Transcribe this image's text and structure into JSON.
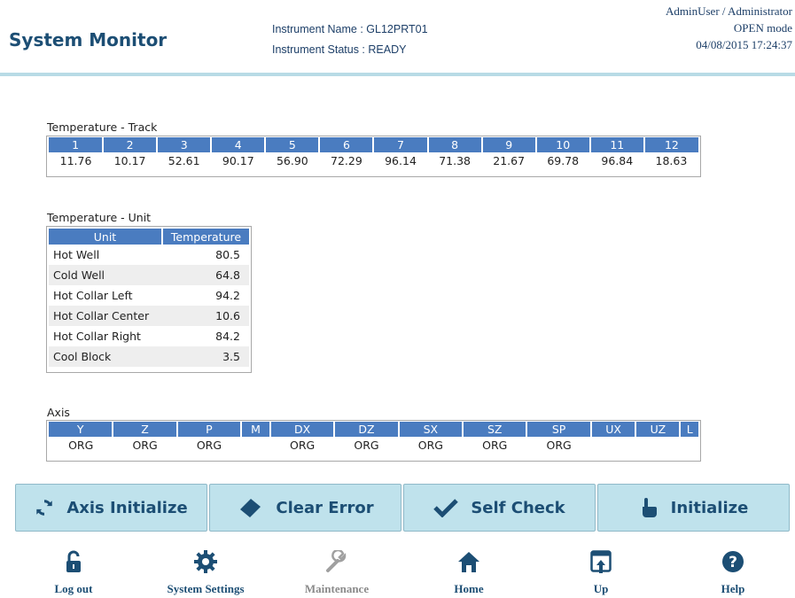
{
  "header": {
    "title": "System Monitor",
    "instrument_name": "Instrument Name :  GL12PRT01",
    "instrument_status": "Instrument Status : READY",
    "user": "AdminUser / Administrator",
    "mode": "OPEN mode",
    "datetime": "04/08/2015 17:24:37"
  },
  "track": {
    "label": "Temperature - Track",
    "headers": [
      "1",
      "2",
      "3",
      "4",
      "5",
      "6",
      "7",
      "8",
      "9",
      "10",
      "11",
      "12"
    ],
    "values": [
      "11.76",
      "10.17",
      "52.61",
      "90.17",
      "56.90",
      "72.29",
      "96.14",
      "71.38",
      "21.67",
      "69.78",
      "96.84",
      "18.63"
    ]
  },
  "unit": {
    "label": "Temperature - Unit",
    "col_unit": "Unit",
    "col_temp": "Temperature",
    "rows": [
      {
        "name": "Hot Well",
        "value": "80.5"
      },
      {
        "name": "Cold Well",
        "value": "64.8"
      },
      {
        "name": "Hot Collar Left",
        "value": "94.2"
      },
      {
        "name": "Hot Collar Center",
        "value": "10.6"
      },
      {
        "name": "Hot Collar Right",
        "value": "84.2"
      },
      {
        "name": "Cool Block",
        "value": "3.5"
      }
    ]
  },
  "axis": {
    "label": "Axis",
    "headers": [
      "Y",
      "Z",
      "P",
      "M",
      "DX",
      "DZ",
      "SX",
      "SZ",
      "SP",
      "UX",
      "UZ",
      "L"
    ],
    "values": [
      "ORG",
      "ORG",
      "ORG",
      "",
      "ORG",
      "ORG",
      "ORG",
      "ORG",
      "ORG",
      "",
      "",
      ""
    ]
  },
  "actions": {
    "axis_initialize": "Axis Initialize",
    "clear_error": "Clear Error",
    "self_check": "Self Check",
    "initialize": "Initialize"
  },
  "nav": {
    "logout": "Log out",
    "system_settings": "System Settings",
    "maintenance": "Maintenance",
    "home": "Home",
    "up": "Up",
    "help": "Help"
  },
  "icons": {
    "axis_initialize": "sync-icon",
    "clear_error": "eraser-icon",
    "self_check": "checkmark-icon",
    "initialize": "hand-pointer-icon",
    "logout": "unlock-icon",
    "system_settings": "gear-icon",
    "maintenance": "wrench-icon",
    "home": "home-icon",
    "up": "up-arrow-icon",
    "help": "help-icon"
  },
  "colors": {
    "header_blue": "#1c4e74",
    "table_header": "#4a7cc0",
    "button_bg": "#bfe2ec"
  }
}
